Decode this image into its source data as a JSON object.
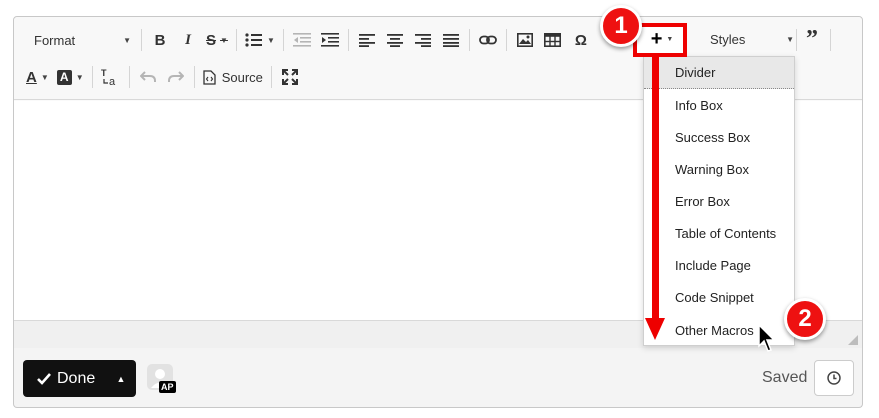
{
  "toolbar": {
    "format_label": "Format",
    "styles_label": "Styles",
    "source_label": "Source",
    "buttons": {
      "bold": "B",
      "italic": "I",
      "strike": "S",
      "insert": "+",
      "blockquote": "”"
    }
  },
  "insert_menu": {
    "items": [
      {
        "label": "Divider"
      },
      {
        "label": "Info Box"
      },
      {
        "label": "Success Box"
      },
      {
        "label": "Warning Box"
      },
      {
        "label": "Error Box"
      },
      {
        "label": "Table of Contents"
      },
      {
        "label": "Include Page"
      },
      {
        "label": "Code Snippet"
      },
      {
        "label": "Other Macros"
      }
    ]
  },
  "footer": {
    "done_label": "Done",
    "avatar_initials": "AP",
    "saved_label": "Saved"
  },
  "annotations": {
    "step1": "1",
    "step2": "2"
  },
  "colors": {
    "accent": "#ee1111",
    "done_bg": "#111111"
  }
}
